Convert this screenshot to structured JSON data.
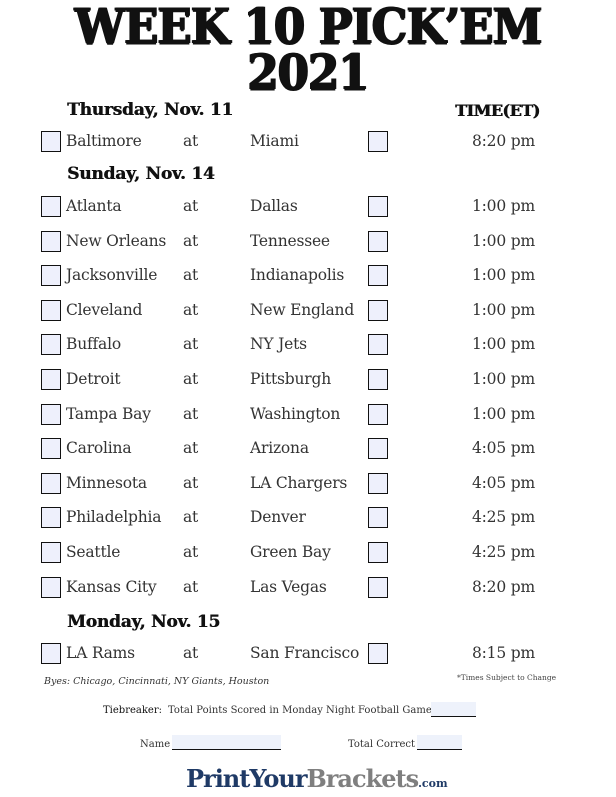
{
  "title": {
    "line1": "WEEK 10 PICK’EM",
    "line2": "2021"
  },
  "time_header": "TIME(ET)",
  "days": [
    {
      "label": "Thursday, Nov. 11",
      "games": [
        {
          "away": "Baltimore",
          "at": "at",
          "home": "Miami",
          "time": "8:20 pm"
        }
      ]
    },
    {
      "label": "Sunday, Nov. 14",
      "games": [
        {
          "away": "Atlanta",
          "at": "at",
          "home": "Dallas",
          "time": "1:00 pm"
        },
        {
          "away": "New Orleans",
          "at": "at",
          "home": "Tennessee",
          "time": "1:00 pm"
        },
        {
          "away": "Jacksonville",
          "at": "at",
          "home": "Indianapolis",
          "time": "1:00 pm"
        },
        {
          "away": "Cleveland",
          "at": "at",
          "home": "New England",
          "time": "1:00 pm"
        },
        {
          "away": "Buffalo",
          "at": "at",
          "home": "NY Jets",
          "time": "1:00 pm"
        },
        {
          "away": "Detroit",
          "at": "at",
          "home": "Pittsburgh",
          "time": "1:00 pm"
        },
        {
          "away": "Tampa Bay",
          "at": "at",
          "home": "Washington",
          "time": "1:00 pm"
        },
        {
          "away": "Carolina",
          "at": "at",
          "home": "Arizona",
          "time": "4:05 pm"
        },
        {
          "away": "Minnesota",
          "at": "at",
          "home": "LA Chargers",
          "time": "4:05 pm"
        },
        {
          "away": "Philadelphia",
          "at": "at",
          "home": "Denver",
          "time": "4:25 pm"
        },
        {
          "away": "Seattle",
          "at": "at",
          "home": "Green Bay",
          "time": "4:25 pm"
        },
        {
          "away": "Kansas City",
          "at": "at",
          "home": "Las Vegas",
          "time": "8:20 pm"
        }
      ]
    },
    {
      "label": "Monday, Nov. 15",
      "games": [
        {
          "away": "LA Rams",
          "at": "at",
          "home": "San Francisco",
          "time": "8:15 pm"
        }
      ]
    }
  ],
  "byes": "Byes: Chicago, Cincinnati, NY Giants, Houston",
  "times_note": "*Times Subject to Change",
  "form": {
    "tiebreaker_label": "Tiebreaker:",
    "tiebreaker_text": "Total Points Scored in Monday Night Football Game",
    "tiebreaker_value": "",
    "name_label": "Name",
    "name_value": "",
    "total_correct_label": "Total Correct",
    "total_correct_value": ""
  },
  "logo": {
    "part1": "PrintYour",
    "part2": "Brackets",
    "part3": ".com"
  },
  "colors": {
    "checkbox_fill": "#eef0fc",
    "logo_blue": "#1f3a66",
    "logo_gray": "#7f7f7f"
  }
}
